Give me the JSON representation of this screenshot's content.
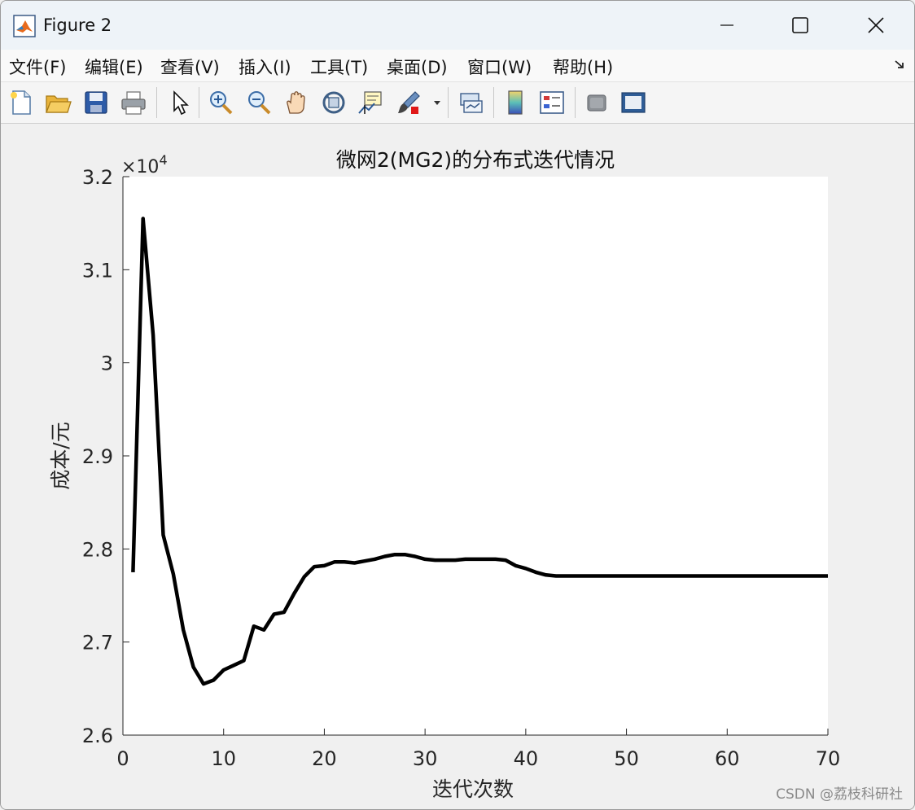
{
  "window": {
    "title": "Figure 2"
  },
  "menu": {
    "items": [
      "文件(F)",
      "编辑(E)",
      "查看(V)",
      "插入(I)",
      "工具(T)",
      "桌面(D)",
      "窗口(W)",
      "帮助(H)"
    ]
  },
  "toolbar": {
    "buttons": [
      "new-figure-icon",
      "open-icon",
      "save-icon",
      "print-icon",
      "pointer-icon",
      "zoom-in-icon",
      "zoom-out-icon",
      "pan-hand-icon",
      "rotate-3d-icon",
      "data-cursor-icon",
      "brush-icon",
      "dropdown-arrow-icon",
      "link-plot-icon",
      "colorbar-icon",
      "legend-icon",
      "hide-plot-tools-icon",
      "show-plot-tools-icon"
    ]
  },
  "chart_data": {
    "type": "line",
    "title": "微网2(MG2)的分布式迭代情况",
    "xlabel": "迭代次数",
    "ylabel": "成本/元",
    "exponent_label": "×10",
    "exponent_power": "4",
    "xlim": [
      0,
      70
    ],
    "ylim": [
      2.6,
      3.2
    ],
    "xticks": [
      "0",
      "10",
      "20",
      "30",
      "40",
      "50",
      "60",
      "70"
    ],
    "yticks": [
      "2.6",
      "2.7",
      "2.8",
      "2.9",
      "3",
      "3.1",
      "3.2"
    ],
    "grid": false,
    "line_color": "#000000",
    "series": [
      {
        "x": [
          1,
          2,
          3,
          4,
          5,
          6,
          7,
          8,
          9,
          10,
          11,
          12,
          13,
          14,
          15,
          16,
          17,
          18,
          19,
          20,
          21,
          22,
          23,
          24,
          25,
          26,
          27,
          28,
          29,
          30,
          31,
          32,
          33,
          34,
          35,
          36,
          37,
          38,
          39,
          40,
          41,
          42,
          43,
          44,
          45,
          50,
          55,
          60,
          65,
          70
        ],
        "y": [
          2.775,
          3.155,
          3.03,
          2.815,
          2.773,
          2.713,
          2.673,
          2.655,
          2.659,
          2.67,
          2.675,
          2.68,
          2.717,
          2.713,
          2.73,
          2.732,
          2.752,
          2.77,
          2.781,
          2.782,
          2.786,
          2.786,
          2.785,
          2.787,
          2.789,
          2.792,
          2.794,
          2.794,
          2.792,
          2.789,
          2.788,
          2.788,
          2.788,
          2.789,
          2.789,
          2.789,
          2.789,
          2.788,
          2.782,
          2.779,
          2.775,
          2.772,
          2.771,
          2.771,
          2.771,
          2.771,
          2.771,
          2.771,
          2.771,
          2.771
        ]
      }
    ]
  },
  "watermark": "CSDN @荔枝科研社"
}
